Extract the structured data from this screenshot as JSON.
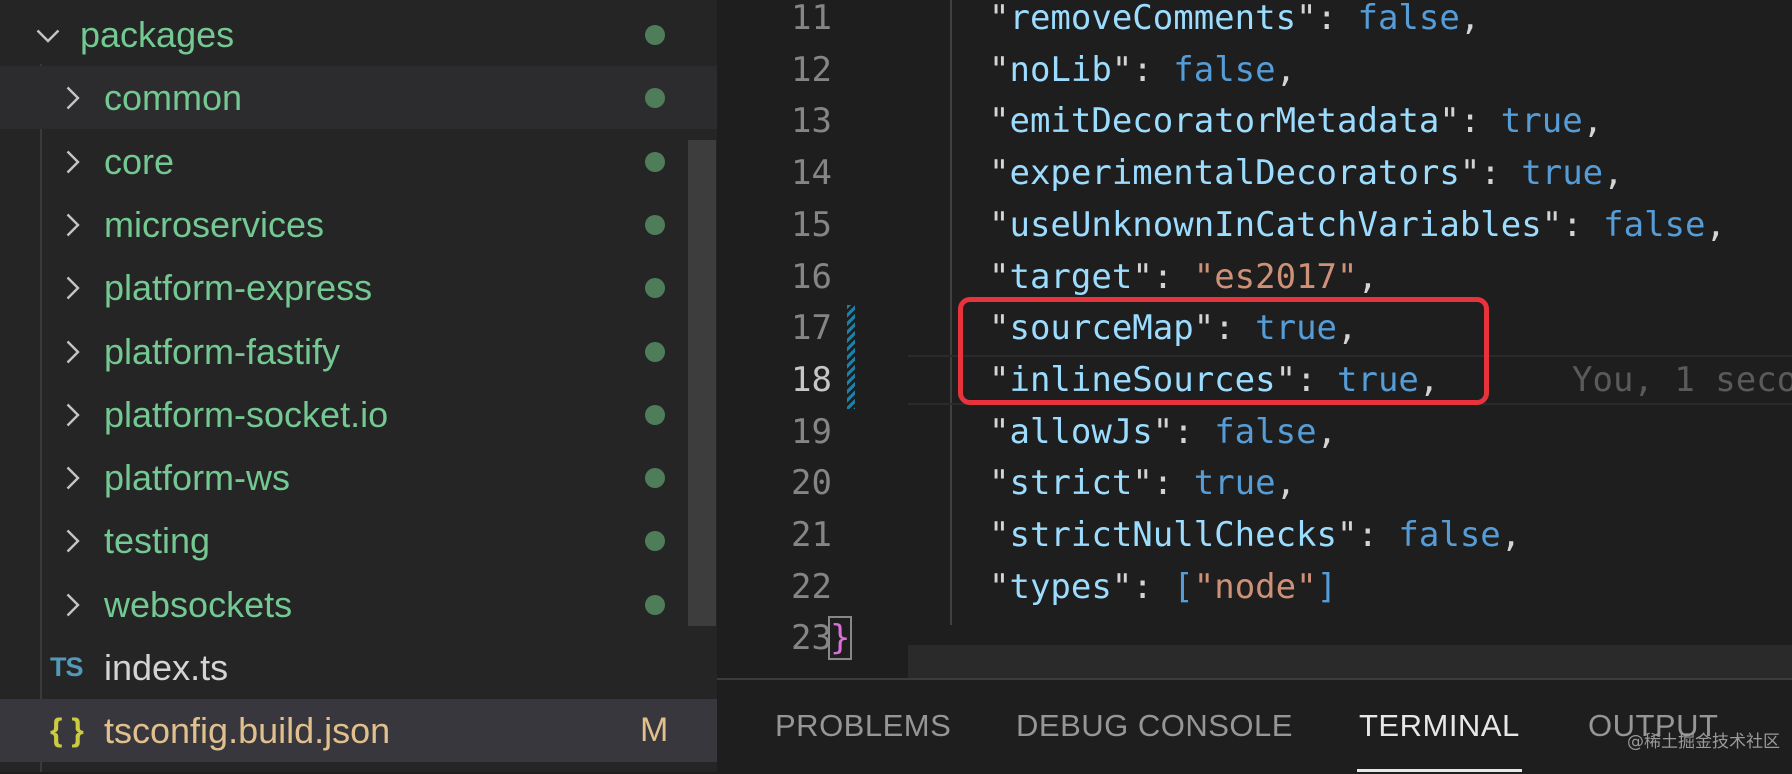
{
  "explorer": {
    "items": [
      {
        "type": "folder",
        "label": "packages",
        "expanded": true,
        "status": "dot"
      },
      {
        "type": "folder",
        "label": "common",
        "expanded": false,
        "status": "dot"
      },
      {
        "type": "folder",
        "label": "core",
        "expanded": false,
        "status": "dot"
      },
      {
        "type": "folder",
        "label": "microservices",
        "expanded": false,
        "status": "dot"
      },
      {
        "type": "folder",
        "label": "platform-express",
        "expanded": false,
        "status": "dot"
      },
      {
        "type": "folder",
        "label": "platform-fastify",
        "expanded": false,
        "status": "dot"
      },
      {
        "type": "folder",
        "label": "platform-socket.io",
        "expanded": false,
        "status": "dot"
      },
      {
        "type": "folder",
        "label": "platform-ws",
        "expanded": false,
        "status": "dot"
      },
      {
        "type": "folder",
        "label": "testing",
        "expanded": false,
        "status": "dot"
      },
      {
        "type": "folder",
        "label": "websockets",
        "expanded": false,
        "status": "dot"
      },
      {
        "type": "file",
        "label": "index.ts",
        "icon": "TS"
      },
      {
        "type": "file",
        "label": "tsconfig.build.json",
        "icon": "{ }",
        "status": "M"
      }
    ]
  },
  "editor": {
    "lines": [
      {
        "num": "11",
        "key": "removeComments",
        "value": "false",
        "kind": "bool",
        "comma": ","
      },
      {
        "num": "12",
        "key": "noLib",
        "value": "false",
        "kind": "bool",
        "comma": ","
      },
      {
        "num": "13",
        "key": "emitDecoratorMetadata",
        "value": "true",
        "kind": "bool",
        "comma": ","
      },
      {
        "num": "14",
        "key": "experimentalDecorators",
        "value": "true",
        "kind": "bool",
        "comma": ","
      },
      {
        "num": "15",
        "key": "useUnknownInCatchVariables",
        "value": "false",
        "kind": "bool",
        "comma": ","
      },
      {
        "num": "16",
        "key": "target",
        "value": "\"es2017\"",
        "kind": "string",
        "comma": ","
      },
      {
        "num": "17",
        "key": "sourceMap",
        "value": "true",
        "kind": "bool",
        "comma": ","
      },
      {
        "num": "18",
        "key": "inlineSources",
        "value": "true",
        "kind": "bool",
        "comma": ","
      },
      {
        "num": "19",
        "key": "allowJs",
        "value": "false",
        "kind": "bool",
        "comma": ","
      },
      {
        "num": "20",
        "key": "strict",
        "value": "true",
        "kind": "bool",
        "comma": ","
      },
      {
        "num": "21",
        "key": "strictNullChecks",
        "value": "false",
        "kind": "bool",
        "comma": ","
      },
      {
        "num": "22",
        "key": "types",
        "value": "[\"node\"]",
        "kind": "array",
        "comma": ""
      },
      {
        "num": "23",
        "key": "",
        "value": "}",
        "kind": "brace",
        "comma": ""
      }
    ],
    "blame_text": "You, 1 seco"
  },
  "panel": {
    "tabs": [
      {
        "label": "PROBLEMS",
        "active": false
      },
      {
        "label": "DEBUG CONSOLE",
        "active": false
      },
      {
        "label": "TERMINAL",
        "active": true
      },
      {
        "label": "OUTPUT",
        "active": false
      }
    ]
  },
  "watermark": "@稀土掘金技术社区"
}
